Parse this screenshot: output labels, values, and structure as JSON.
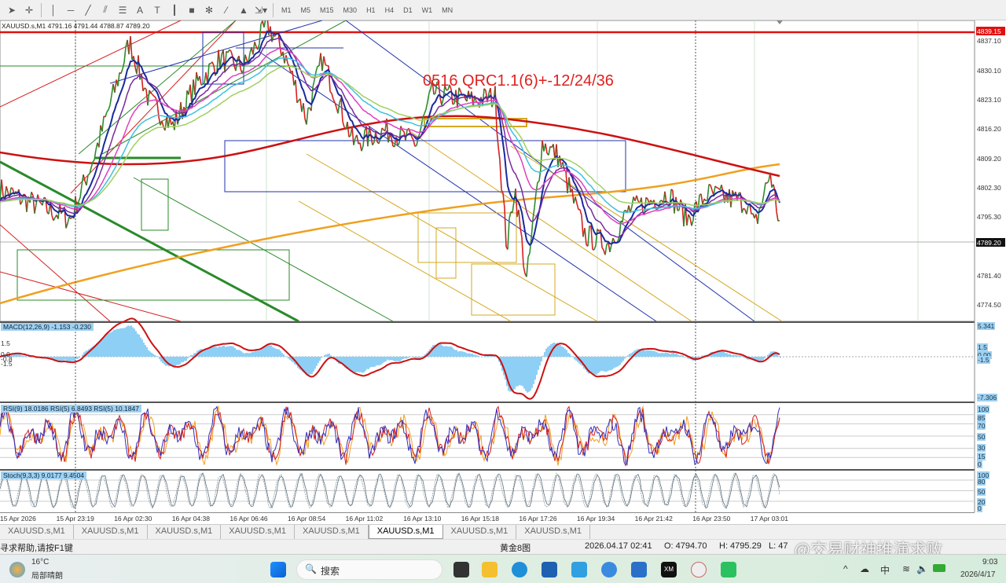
{
  "toolbar": {
    "tools": [
      "cursor-icon",
      "crosshair-icon",
      "vertical-line-icon",
      "horizontal-line-icon",
      "trendline-icon",
      "equidistant-channel-icon",
      "fibonacci-icon",
      "text-icon",
      "text-label-icon",
      "period-separator-icon",
      "rectangle-icon",
      "gann-grid-icon",
      "gann-line-icon",
      "triangle-icon",
      "arrows-icon"
    ],
    "text_tool": "A",
    "timeframes": [
      "M1",
      "M5",
      "M15",
      "M30",
      "H1",
      "H4",
      "D1",
      "W1",
      "MN"
    ]
  },
  "chart": {
    "symbol_info": "XAUUSD.s,M1  4791.16 4791.44 4788.87 4789.20",
    "annotation": "0516  QRC1.1(6)+-12/24/36",
    "price_levels": [
      "4837.10",
      "4830.10",
      "4823.10",
      "4816.20",
      "4809.20",
      "4802.30",
      "4795.30",
      "4781.40",
      "4774.50"
    ],
    "current_price": "4789.20",
    "red_line_price": "4839.15",
    "colors": {
      "price_up": "#2e8b2e",
      "price_down": "#d42020",
      "ma_fast": "#1a2a9c",
      "ma_slow": "#cc1111",
      "ma_orange": "#f0a020"
    }
  },
  "chart_data": {
    "type": "line",
    "series": [
      {
        "name": "XAUUSD.s M1 close (approx)",
        "x": [
          0,
          90,
          120,
          165,
          190,
          220,
          250,
          280,
          310,
          340,
          360,
          390,
          410,
          450,
          490,
          530,
          550,
          600,
          630,
          645,
          655,
          670,
          690,
          710,
          745,
          775,
          800,
          850,
          875,
          900,
          950,
          960,
          980,
          992
        ],
        "y": [
          4797,
          4790,
          4805,
          4832,
          4818,
          4812,
          4822,
          4828,
          4826,
          4836,
          4830,
          4814,
          4828,
          4808,
          4811,
          4808,
          4820,
          4818,
          4819,
          4783,
          4798,
          4775,
          4808,
          4805,
          4786,
          4784,
          4792,
          4796,
          4790,
          4796,
          4794,
          4788,
          4801,
          4789
        ]
      }
    ],
    "ylim": [
      4771,
      4842
    ]
  },
  "macd": {
    "label": "MACD(12,26,9) -1.153 -0.230",
    "levels": [
      "5.341",
      "1.5",
      "0.00",
      "-1.5",
      "-7.306"
    ],
    "left_levels": [
      "1.5",
      "0.0",
      "-0.8",
      "-1.5"
    ]
  },
  "rsi": {
    "label": "RSI(9) 18.0186  RSI(5) 6.8493  RSI(5) 10.1847",
    "levels": [
      "100",
      "85",
      "70",
      "50",
      "30",
      "15",
      "0"
    ]
  },
  "stoch": {
    "label": "Stoch(9,3,3) 9.0177 9.4504",
    "levels": [
      "100",
      "80",
      "50",
      "20",
      "0"
    ]
  },
  "time_axis": [
    "15 Apr 2026",
    "15 Apr 23:19",
    "16 Apr 02:30",
    "16 Apr 04:38",
    "16 Apr 06:46",
    "16 Apr 08:54",
    "16 Apr 11:02",
    "16 Apr 13:10",
    "16 Apr 15:18",
    "16 Apr 17:26",
    "16 Apr 19:34",
    "16 Apr 21:42",
    "16 Apr 23:50",
    "17 Apr 03:01"
  ],
  "tabs": [
    "XAUUSD.s,M1",
    "XAUUSD.s,M1",
    "XAUUSD.s,M1",
    "XAUUSD.s,M1",
    "XAUUSD.s,M1",
    "XAUUSD.s,M1",
    "XAUUSD.s,M1",
    "XAUUSD.s,M1"
  ],
  "active_tab": 5,
  "status": {
    "help": "寻求帮助,请按F1键",
    "profile": "黄金8图",
    "datetime": "2026.04.17 02:41",
    "open": "O: 4794.70",
    "high": "H: 4795.29",
    "low": "L: 47"
  },
  "watermark": "@交易财神推演求败",
  "taskbar": {
    "weather_temp": "16°C",
    "weather_desc": "局部晴朗",
    "search_placeholder": "搜索",
    "ime": "中",
    "time": "9:03",
    "date": "2026/4/17"
  }
}
